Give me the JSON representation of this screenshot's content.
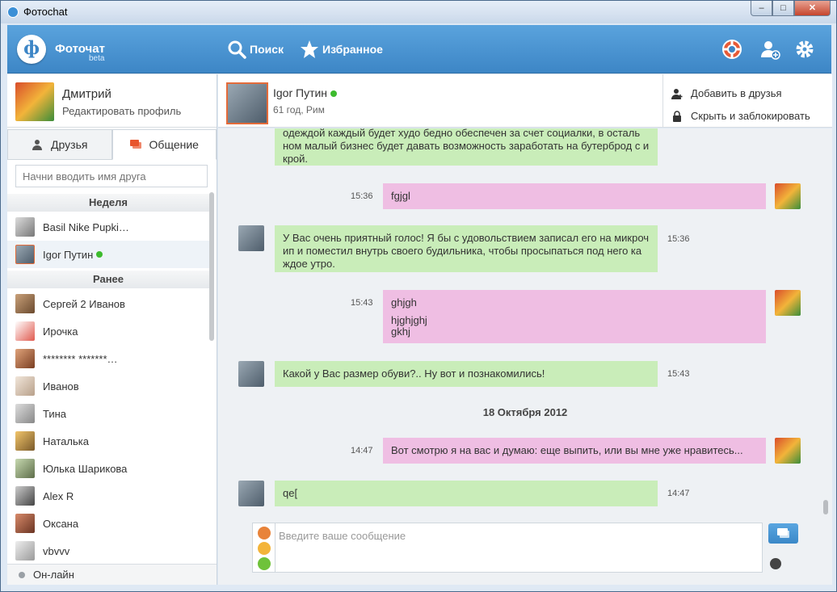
{
  "window": {
    "title": "Фотоchat",
    "min": "–",
    "max": "□",
    "close": "✕"
  },
  "header": {
    "app_name": "Фоточат",
    "beta": "beta",
    "search": "Поиск",
    "favorites": "Избранное"
  },
  "profile": {
    "name": "Дмитрий",
    "edit": "Редактировать профиль"
  },
  "tabs": {
    "friends": "Друзья",
    "chat": "Общение"
  },
  "search": {
    "placeholder": "Начни вводить имя друга"
  },
  "sections": {
    "week": "Неделя",
    "earlier": "Ранее"
  },
  "friends_week": [
    {
      "name": "Basil Nike Pupki…"
    },
    {
      "name": "Igor Путин"
    }
  ],
  "friends_earlier": [
    {
      "name": "Сергей 2 Иванов"
    },
    {
      "name": "Ирочка"
    },
    {
      "name": "******** *******…"
    },
    {
      "name": "Иванов"
    },
    {
      "name": "Тина"
    },
    {
      "name": "Наталька"
    },
    {
      "name": "Юлька Шарикова"
    },
    {
      "name": "Alex R"
    },
    {
      "name": "Оксана"
    },
    {
      "name": "vbvvv"
    }
  ],
  "online": "Он-лайн",
  "contact": {
    "name": "Igor Путин",
    "info": "61 год, Рим"
  },
  "actions": {
    "add": "Добавить в друзья",
    "block": "Скрыть и заблокировать"
  },
  "messages": [
    {
      "from": "them",
      "text": "одеждой каждый будет худо бедно обеспечен за счет социалки, в осталь ном малый бизнес будет давать возможность заработать на бутерброд с и крой.",
      "time": ""
    },
    {
      "from": "me",
      "text": "fgjgl",
      "time": "15:36"
    },
    {
      "from": "them",
      "text": "У Вас очень приятный голос! Я бы с удовольствием записал его на микроч ип и поместил внутрь своего будильника, чтобы просыпаться под него ка ждое утро.",
      "time": "15:36"
    },
    {
      "from": "me",
      "text_lines": [
        "ghjgh",
        "hjghjghj",
        "gkhj"
      ],
      "time": "15:43"
    },
    {
      "from": "them",
      "text": "Какой у Вас размер обуви?.. Ну вот и познакомились!",
      "time": "15:43"
    },
    {
      "from": "me",
      "text": "Вот смотрю я на вас и думаю: еще выпить, или вы мне уже нравитесь...",
      "time": "14:47"
    },
    {
      "from": "them",
      "text": "qe[",
      "time": "14:47"
    }
  ],
  "date_separator": "18 Октября 2012",
  "composer": {
    "placeholder": "Введите ваше сообщение"
  },
  "colors": {
    "header": "#3d86c6",
    "bubble_them": "#c9edb9",
    "bubble_me": "#efbee3",
    "online_dot": "#3dbb2e"
  }
}
